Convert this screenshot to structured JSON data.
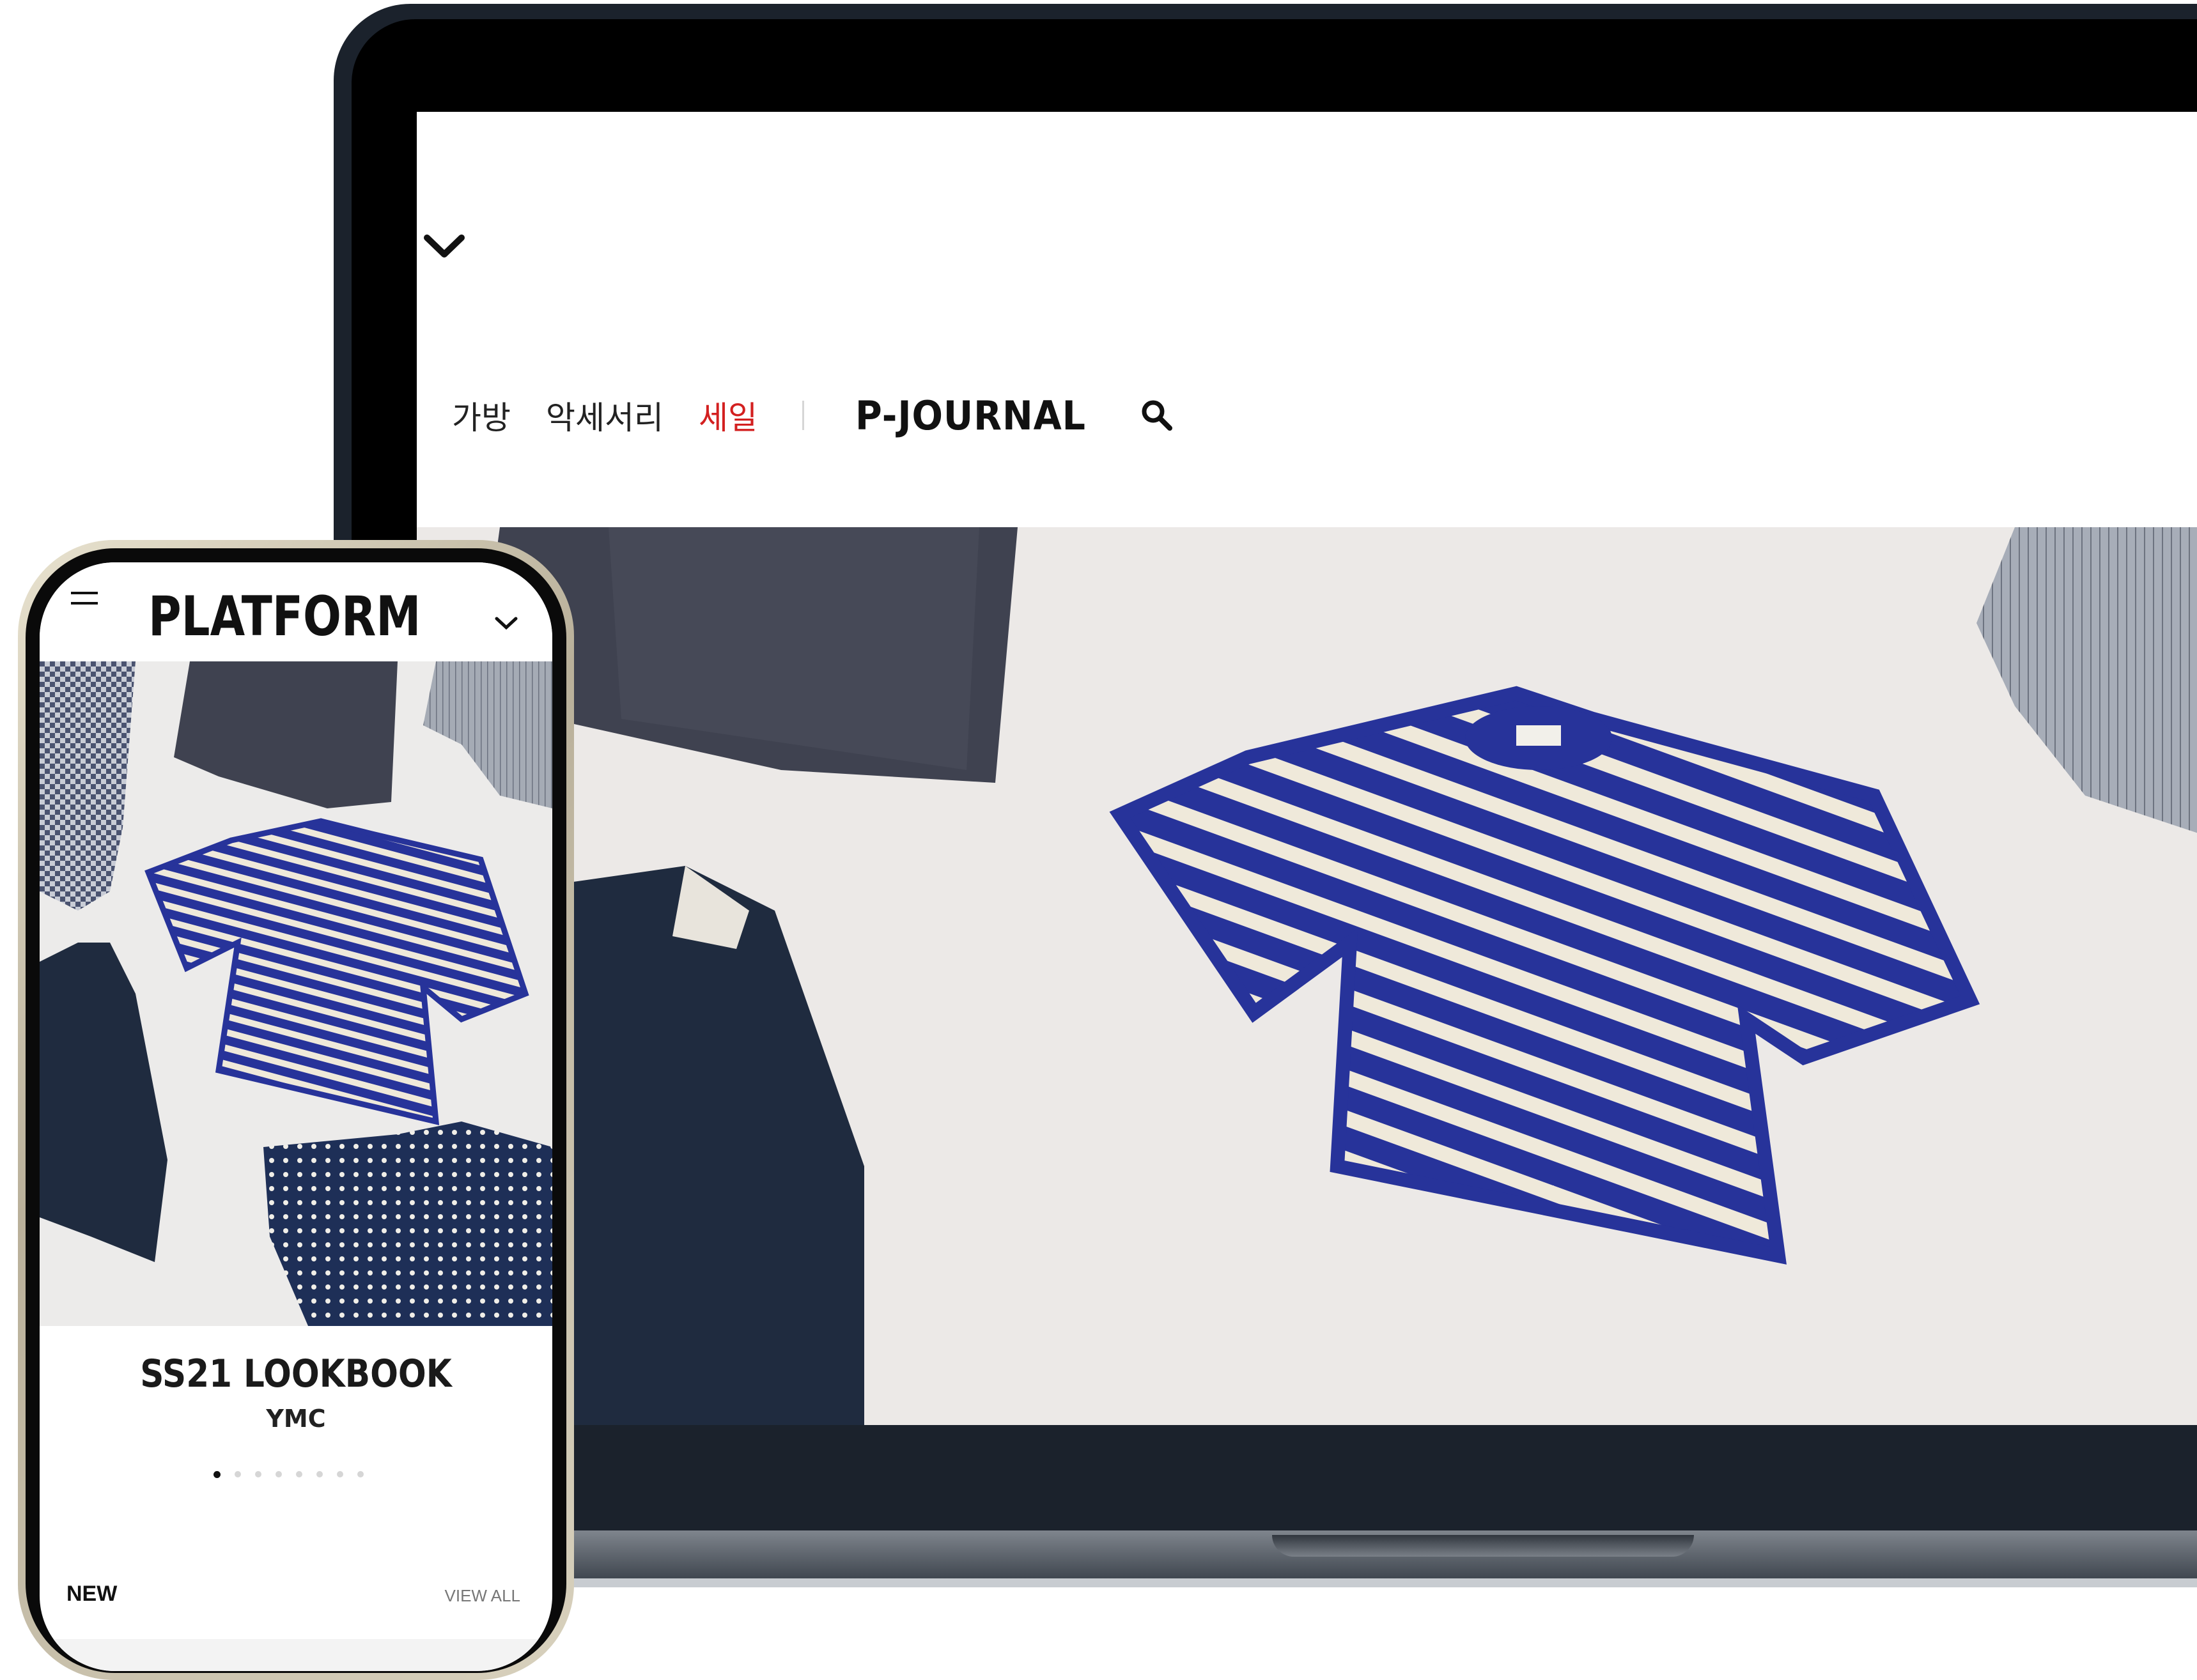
{
  "desktop": {
    "nav": {
      "items": [
        "가방",
        "악세서리",
        "세일"
      ],
      "journal_label": "P-JOURNAL"
    },
    "icons": [
      "chevron-down-icon",
      "search-icon"
    ],
    "colors": {
      "sale": "#d32020",
      "hero_bg": "#ece9e7"
    }
  },
  "phone": {
    "logo": "PLATFORM",
    "slide": {
      "title": "SS21 LOOKBOOK",
      "subtitle": "YMC",
      "dot_count": 8,
      "active_index": 0
    },
    "section": {
      "title": "NEW",
      "view_all": "VIEW ALL"
    },
    "icons": [
      "menu-icon",
      "chevron-down-icon"
    ]
  },
  "product_labels": {
    "tag": "YMC"
  }
}
